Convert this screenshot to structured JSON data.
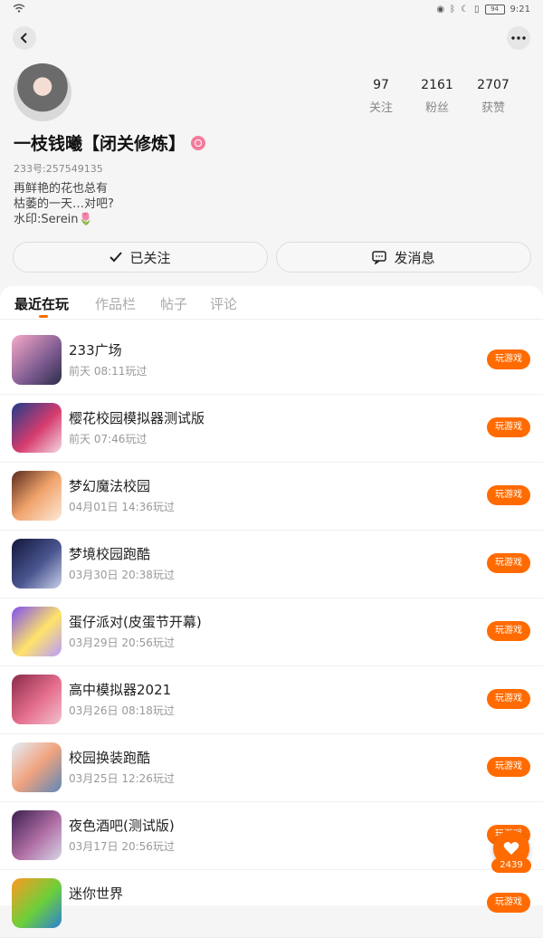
{
  "status_bar": {
    "time": "9:21",
    "battery": "94"
  },
  "profile": {
    "nickname": "一枝钱曦【闭关修炼】",
    "user_id": "233号:257549135",
    "bio_lines": [
      "再鲜艳的花也总有",
      "枯萎的一天…对吧?",
      "水印:Serein🌷"
    ],
    "stats": [
      {
        "value": "97",
        "label": "关注"
      },
      {
        "value": "2161",
        "label": "粉丝"
      },
      {
        "value": "2707",
        "label": "获赞"
      }
    ]
  },
  "actions": {
    "follow_label": "已关注",
    "message_label": "发消息"
  },
  "tabs": [
    "最近在玩",
    "作品栏",
    "帖子",
    "评论"
  ],
  "games": [
    {
      "name": "233广场",
      "time": "前天 08:11玩过",
      "button": "玩游戏"
    },
    {
      "name": "樱花校园模拟器测试版",
      "time": "前天 07:46玩过",
      "button": "玩游戏"
    },
    {
      "name": "梦幻魔法校园",
      "time": "04月01日 14:36玩过",
      "button": "玩游戏"
    },
    {
      "name": "梦境校园跑酷",
      "time": "03月30日 20:38玩过",
      "button": "玩游戏"
    },
    {
      "name": "蛋仔派对(皮蛋节开幕)",
      "time": "03月29日 20:56玩过",
      "button": "玩游戏"
    },
    {
      "name": "高中模拟器2021",
      "time": "03月26日 08:18玩过",
      "button": "玩游戏"
    },
    {
      "name": "校园换装跑酷",
      "time": "03月25日 12:26玩过",
      "button": "玩游戏"
    },
    {
      "name": "夜色酒吧(测试版)",
      "time": "03月17日 20:56玩过",
      "button": "玩游戏"
    },
    {
      "name": "迷你世界",
      "time": "",
      "button": "玩游戏"
    }
  ],
  "fab": {
    "count": "2439"
  },
  "colors": {
    "accent": "#ff6b00",
    "background": "#f5f5f5"
  },
  "icons": [
    "wifi-icon",
    "back-icon",
    "more-icon",
    "check-icon",
    "message-icon",
    "heart-icon"
  ]
}
